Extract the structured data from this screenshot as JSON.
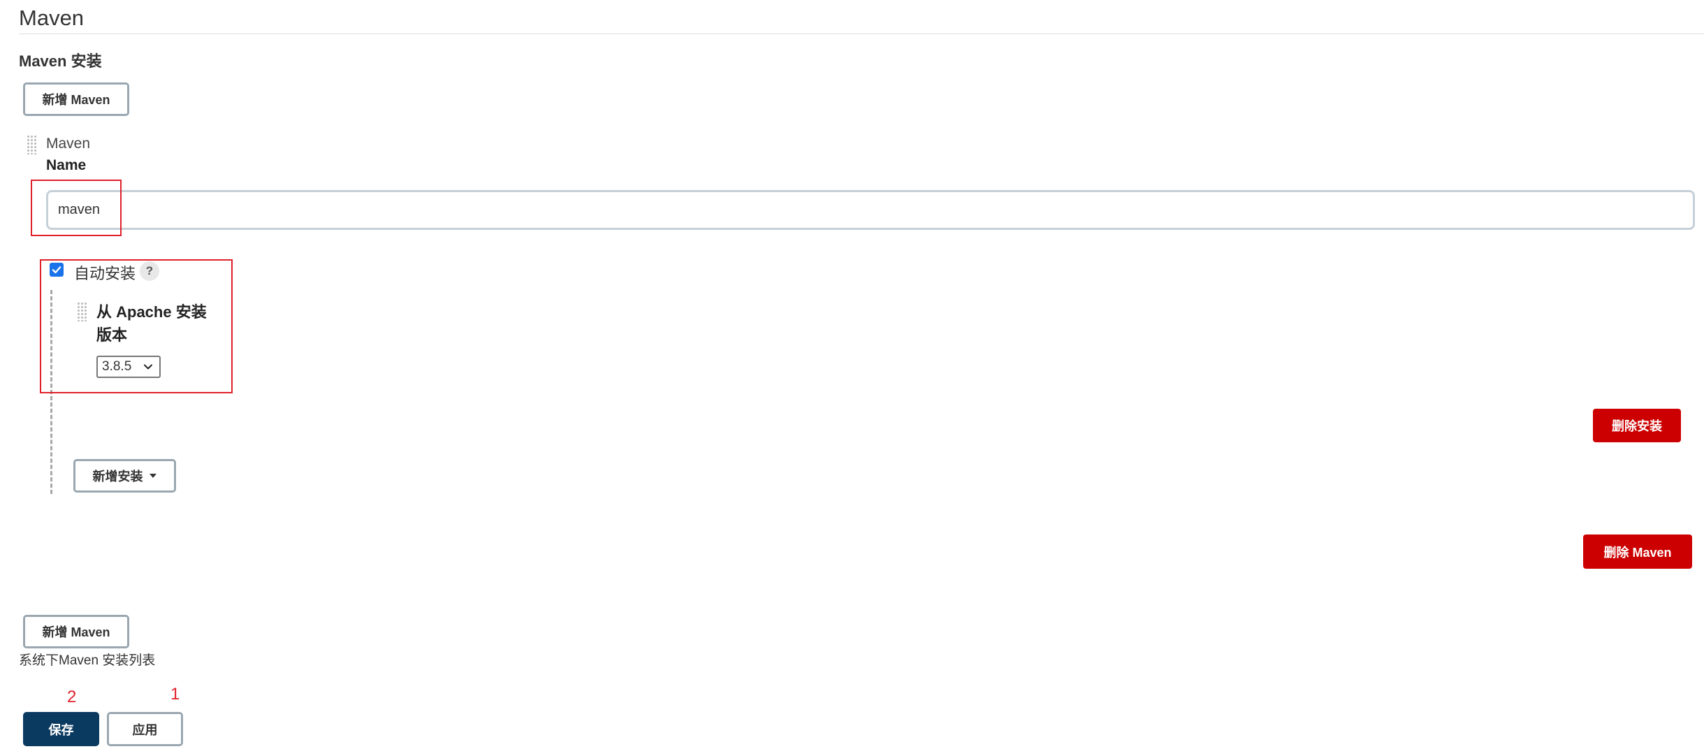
{
  "section": {
    "title": "Maven",
    "subtitle": "Maven 安装"
  },
  "buttons": {
    "add_maven_top": "新增 Maven",
    "delete_installer": "删除安装",
    "add_installer": "新增安装",
    "delete_maven": "删除 Maven",
    "add_maven_bottom": "新增 Maven",
    "save": "保存",
    "apply": "应用"
  },
  "maven_entry": {
    "repeat_title": "Maven",
    "name_label": "Name",
    "name_value": "maven",
    "auto_install_label": "自动安装",
    "auto_install_checked": true,
    "help_glyph": "?",
    "installer_title": "从 Apache 安装",
    "version_label": "版本",
    "version_selected": "3.8.5"
  },
  "helper_text": "系统下Maven 安装列表",
  "annotations": {
    "save_marker": "2",
    "apply_marker": "1"
  },
  "colors": {
    "danger": "#cc0000",
    "primary": "#0b3a61",
    "highlight_border": "#e0202a",
    "checkbox": "#1a73e8"
  }
}
